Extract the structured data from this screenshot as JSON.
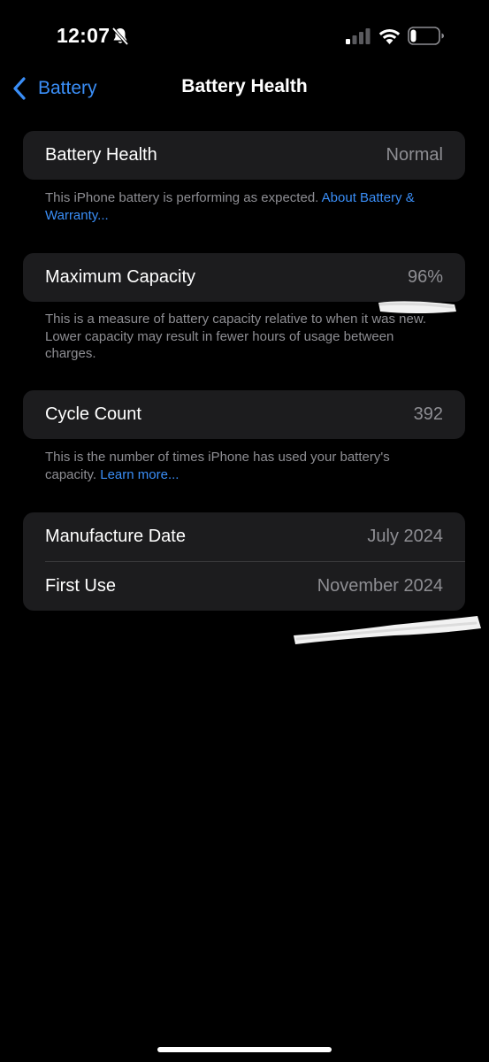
{
  "status_bar": {
    "time": "12:07",
    "icons": [
      "bell-slash-icon",
      "signal-icon",
      "wifi-icon",
      "battery-icon"
    ],
    "battery_level": 0.2
  },
  "nav": {
    "back_label": "Battery",
    "title": "Battery Health"
  },
  "battery_health": {
    "label": "Battery Health",
    "value": "Normal",
    "footnote_text": "This iPhone battery is performing as expected. ",
    "footnote_link": "About Battery & Warranty..."
  },
  "maximum_capacity": {
    "label": "Maximum Capacity",
    "value": "96%",
    "footnote_text": "This is a measure of battery capacity relative to when it was new. Lower capacity may result in fewer hours of usage between charges."
  },
  "cycle_count": {
    "label": "Cycle Count",
    "value": "392",
    "footnote_text": "This is the number of times iPhone has used your battery's capacity. ",
    "footnote_link": "Learn more..."
  },
  "dates": {
    "manufacture_label": "Manufacture Date",
    "manufacture_value": "July 2024",
    "first_use_label": "First Use",
    "first_use_value": "November 2024"
  },
  "colors": {
    "background": "#000000",
    "card": "#1c1c1e",
    "accent": "#3a8ef7",
    "secondary_text": "#8e8e93"
  }
}
